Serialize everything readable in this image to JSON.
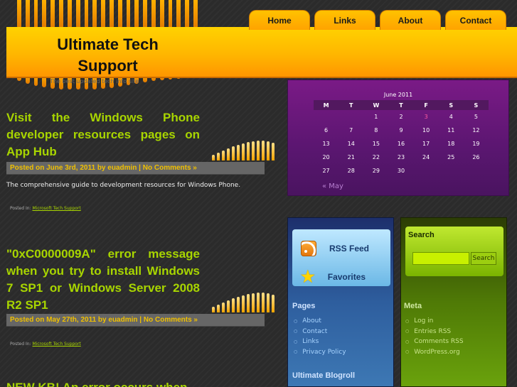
{
  "site": {
    "title": "Ultimate Tech Support",
    "tagline": "The best updated tech info site"
  },
  "nav": [
    "Home",
    "Links",
    "About",
    "Contact"
  ],
  "calendar": {
    "caption": "June 2011",
    "weekdays": [
      "M",
      "T",
      "W",
      "T",
      "F",
      "S",
      "S"
    ],
    "weeks": [
      [
        "",
        "",
        "1",
        "2",
        "3",
        "4",
        "5"
      ],
      [
        "6",
        "7",
        "8",
        "9",
        "10",
        "11",
        "12"
      ],
      [
        "13",
        "14",
        "15",
        "16",
        "17",
        "18",
        "19"
      ],
      [
        "20",
        "21",
        "22",
        "23",
        "24",
        "25",
        "26"
      ],
      [
        "27",
        "28",
        "29",
        "30",
        "",
        "",
        ""
      ]
    ],
    "today": "3",
    "prev_link": "« May"
  },
  "posts": [
    {
      "title": "Visit the Windows Phone developer resources pages on App Hub",
      "meta": "Posted on June 3rd, 2011 by euadmin",
      "comments": "No Comments »",
      "excerpt": "The comprehensive guide to development resources for Windows Phone.",
      "posted_in_label": "Posted In:",
      "category": "Microsoft Tech Support"
    },
    {
      "title": "\"0xC0000009A\" error message when you try to install Windows 7 SP1 or Windows Server 2008 R2 SP1",
      "meta": "Posted on May 27th, 2011 by euadmin",
      "comments": "No Comments »",
      "excerpt": "",
      "posted_in_label": "Posted In:",
      "category": "Microsoft Tech Support"
    },
    {
      "title": "NEW KB! An error occurs when",
      "meta": "",
      "comments": "",
      "excerpt": "",
      "posted_in_label": "",
      "category": ""
    }
  ],
  "sidebar_blue": {
    "rss_label": "RSS Feed",
    "favorites_label": "Favorites",
    "pages_heading": "Pages",
    "pages": [
      "About",
      "Contact",
      "Links",
      "Privacy Policy"
    ],
    "blogroll_heading": "Ultimate Blogroll"
  },
  "sidebar_green": {
    "search_heading": "Search",
    "search_button": "Search",
    "search_value": "",
    "meta_heading": "Meta",
    "meta_items": [
      "Log in",
      "Entries RSS",
      "Comments RSS",
      "WordPress.org"
    ]
  },
  "colors": {
    "header_orange": "#ffb600",
    "post_title_green": "#a8d500",
    "meta_yellow": "#f0c000",
    "calendar_purple": "#5a1670",
    "sidebar_blue": "#2e5e9e",
    "sidebar_green": "#4f7a06"
  },
  "icons": {
    "rss": "rss-icon",
    "favorites": "star-icon",
    "bullet": "bullet-icon"
  }
}
